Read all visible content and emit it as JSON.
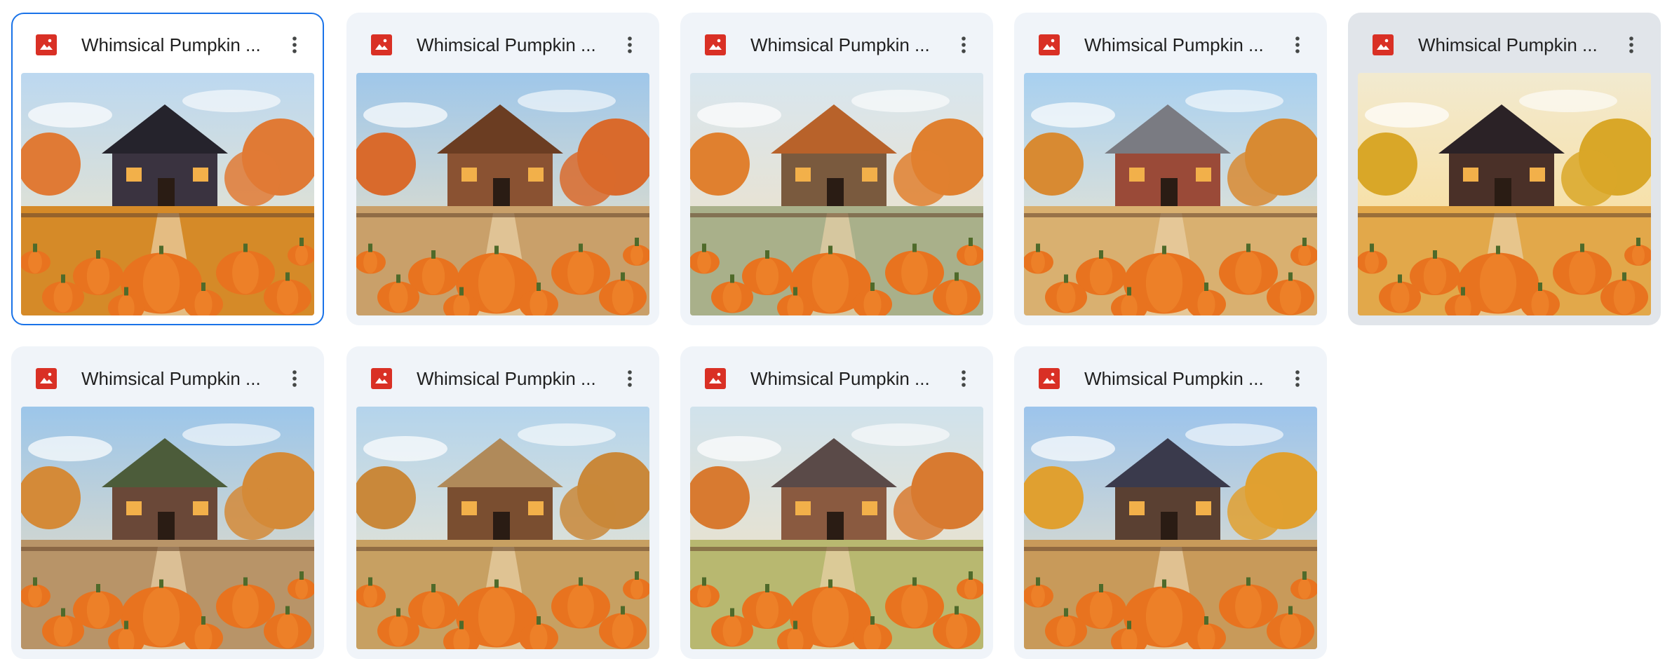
{
  "files": [
    {
      "title": "Whimsical Pumpkin ...",
      "state": "selected"
    },
    {
      "title": "Whimsical Pumpkin ...",
      "state": "normal"
    },
    {
      "title": "Whimsical Pumpkin ...",
      "state": "normal"
    },
    {
      "title": "Whimsical Pumpkin ...",
      "state": "normal"
    },
    {
      "title": "Whimsical Pumpkin ...",
      "state": "hovered"
    },
    {
      "title": "Whimsical Pumpkin ...",
      "state": "normal"
    },
    {
      "title": "Whimsical Pumpkin ...",
      "state": "normal"
    },
    {
      "title": "Whimsical Pumpkin ...",
      "state": "normal"
    },
    {
      "title": "Whimsical Pumpkin ...",
      "state": "normal"
    }
  ],
  "icons": {
    "file_type": "image-file-icon",
    "menu": "more-vert-icon"
  },
  "colors": {
    "image_icon": "#d93025",
    "selection_border": "#1a73e8",
    "card_bg": "#f0f4f9",
    "card_hover_bg": "#e1e5ea"
  }
}
